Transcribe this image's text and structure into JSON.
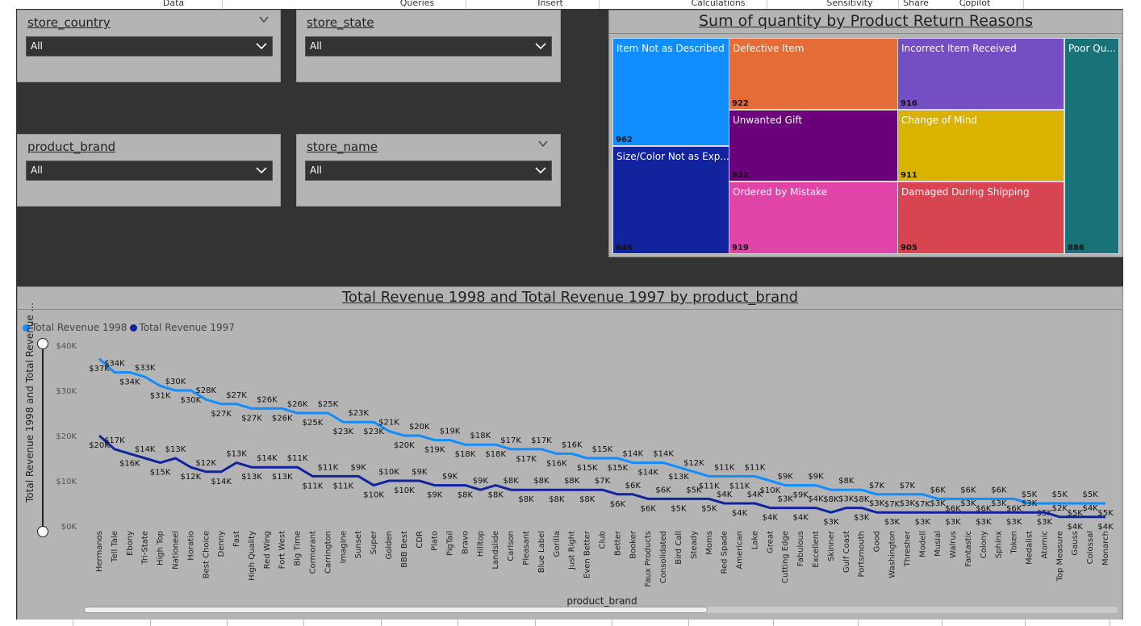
{
  "ribbon": {
    "tabs": [
      {
        "label": "Data",
        "center": 215
      },
      {
        "label": "Queries",
        "center": 517
      },
      {
        "label": "Insert",
        "center": 682
      },
      {
        "label": "Calculations",
        "center": 890
      },
      {
        "label": "Sensitivity",
        "center": 1053
      },
      {
        "label": "Share",
        "center": 1135
      },
      {
        "label": "Copilot",
        "center": 1208
      }
    ]
  },
  "slicers": [
    {
      "id": "store-country",
      "title": "store_country",
      "value": "All"
    },
    {
      "id": "store-state",
      "title": "store_state",
      "value": "All"
    },
    {
      "id": "product-brand",
      "title": "product_brand",
      "value": "All"
    },
    {
      "id": "store-name",
      "title": "store_name",
      "value": "All"
    }
  ],
  "treemap": {
    "title": "Sum of quantity by Product Return Reasons",
    "tiles": [
      {
        "label": "Item Not as Described",
        "value": "962",
        "color": "#118DFF"
      },
      {
        "label": "Size/Color Not as Exp...",
        "value": "946",
        "color": "#12239E"
      },
      {
        "label": "Defective Item",
        "value": "922",
        "color": "#E66C37"
      },
      {
        "label": "Unwanted Gift",
        "value": "922",
        "color": "#6B007B"
      },
      {
        "label": "Ordered by Mistake",
        "value": "919",
        "color": "#E044A7"
      },
      {
        "label": "Incorrect Item Received",
        "value": "916",
        "color": "#744EC2"
      },
      {
        "label": "Change of Mind",
        "value": "911",
        "color": "#D9B300"
      },
      {
        "label": "Damaged During Shipping",
        "value": "905",
        "color": "#D64550"
      },
      {
        "label": "Poor Qu...",
        "value": "886",
        "color": "#197278"
      }
    ]
  },
  "chart_data": {
    "type": "line",
    "title": "Total Revenue 1998 and Total Revenue 1997 by product_brand",
    "xlabel": "product_brand",
    "ylabel": "Total Revenue 1998 and Total Revenue ...",
    "ylim": [
      0,
      40000
    ],
    "yticks": [
      "$0K",
      "$10K",
      "$20K",
      "$30K",
      "$40K"
    ],
    "legend_position": "top-left",
    "categories": [
      "Hermanos",
      "Tell Tale",
      "Ebony",
      "Tri-State",
      "High Top",
      "Nationeel",
      "Horatio",
      "Best Choice",
      "Denny",
      "Fast",
      "High Quality",
      "Red Wing",
      "Fort West",
      "Big Time",
      "Cormorant",
      "Carrington",
      "Imagine",
      "Sunset",
      "Super",
      "Golden",
      "BBB Best",
      "CDR",
      "Plato",
      "PigTail",
      "Bravo",
      "Hilltop",
      "Landslide",
      "Carlson",
      "Pleasant",
      "Blue Label",
      "Gorilla",
      "Just Right",
      "Even Better",
      "Club",
      "Better",
      "Booker",
      "Faux Products",
      "Consolidated",
      "Bird Call",
      "Steady",
      "Moms",
      "Red Spade",
      "American",
      "Lake",
      "Great",
      "Cutting Edge",
      "Fabulous",
      "Excellent",
      "Skinner",
      "Gulf Coast",
      "Portsmouth",
      "Good",
      "Washington",
      "Thresher",
      "Modell",
      "Musial",
      "Walrus",
      "Fantastic",
      "Colony",
      "Sphinx",
      "Token",
      "Medalist",
      "Atomic",
      "Top Measure",
      "Gauss",
      "Colossal",
      "Monarch"
    ],
    "series": [
      {
        "name": "Total Revenue 1998",
        "color": "#118DFF",
        "values": [
          37000,
          34000,
          34000,
          33000,
          31000,
          30000,
          30000,
          28000,
          27000,
          27000,
          26000,
          26000,
          26000,
          25000,
          25000,
          25000,
          23000,
          23000,
          23000,
          21000,
          20000,
          20000,
          19000,
          19000,
          18000,
          18000,
          18000,
          17000,
          17000,
          17000,
          16000,
          16000,
          15000,
          15000,
          15000,
          14000,
          14000,
          14000,
          13000,
          12000,
          11000,
          11000,
          11000,
          11000,
          10000,
          9000,
          9000,
          9000,
          8000,
          8000,
          8000,
          7000,
          7000,
          7000,
          7000,
          6000,
          6000,
          6000,
          6000,
          6000,
          6000,
          5000,
          5000,
          5000,
          5000,
          5000,
          5000
        ],
        "labels": [
          "$37K",
          "$34K",
          "$34K",
          "$33K",
          "$31K",
          "$30K",
          "$30K",
          "$28K",
          "$27K",
          "$27K",
          "$27K",
          "$26K",
          "$26K",
          "$26K",
          "$25K",
          "$25K",
          "$23K",
          "$23K",
          "$23K",
          "$21K",
          "$20K",
          "$20K",
          "$19K",
          "$19K",
          "$18K",
          "$18K",
          "$18K",
          "$17K",
          "$17K",
          "$17K",
          "$16K",
          "$16K",
          "$15K",
          "$15K",
          "$15K",
          "$14K",
          "$14K",
          "$14K",
          "$13K",
          "$12K",
          "$11K",
          "$11K",
          "$11K",
          "$11K",
          "$10K",
          "$9K",
          "$9K",
          "$9K",
          "$8K",
          "$8K",
          "$8K",
          "$7K",
          "$7K",
          "$7K",
          "$7K",
          "$6K",
          "$6K",
          "$6K",
          "$6K",
          "$6K",
          "$6K",
          "$5K",
          "$5K",
          "$5K",
          "$5K",
          "$5K",
          "$5K"
        ]
      },
      {
        "name": "Total Revenue 1997",
        "color": "#12239E",
        "values": [
          20000,
          17000,
          16000,
          15000,
          14000,
          15000,
          13000,
          12000,
          12000,
          14000,
          13000,
          13000,
          13000,
          13000,
          11000,
          11000,
          11000,
          11000,
          9000,
          10000,
          10000,
          10000,
          9000,
          9000,
          9000,
          8000,
          9000,
          8000,
          8000,
          8000,
          8000,
          8000,
          8000,
          8000,
          7000,
          7000,
          6000,
          6000,
          6000,
          6000,
          6000,
          5000,
          5000,
          5000,
          4000,
          4000,
          4000,
          4000,
          3000,
          4000,
          4000,
          3000,
          3000,
          3000,
          3000,
          3000,
          3000,
          3000,
          3000,
          3000,
          3000,
          3000,
          3000,
          2000,
          2000,
          2000,
          2000
        ],
        "labels": [
          "$20K",
          "$17K",
          "$16K",
          "$14K",
          "$15K",
          "$13K",
          "$12K",
          "$12K",
          "$14K",
          "$13K",
          "$13K",
          "$14K",
          "$13K",
          "$11K",
          "$11K",
          "$11K",
          "$11K",
          "$9K",
          "$10K",
          "$10K",
          "$10K",
          "$9K",
          "$9K",
          "$9K",
          "$8K",
          "$9K",
          "$8K",
          "$8K",
          "$8K",
          "$8K",
          "$8K",
          "$8K",
          "$8K",
          "$7K",
          "$6K",
          "$6K",
          "$6K",
          "$6K",
          "$5K",
          "$5K",
          "$5K",
          "$4K",
          "$4K",
          "$4K",
          "$4K",
          "$3K",
          "$4K",
          "$4K",
          "$3K",
          "$3K",
          "$3K",
          "$3K",
          "$3K",
          "$3K",
          "$3K",
          "$3K",
          "$3K",
          "$3K",
          "$3K",
          "$3K",
          "$3K",
          "$3K",
          "$3K",
          "$2K",
          "$4K",
          "$4K",
          "$4K"
        ]
      }
    ]
  }
}
